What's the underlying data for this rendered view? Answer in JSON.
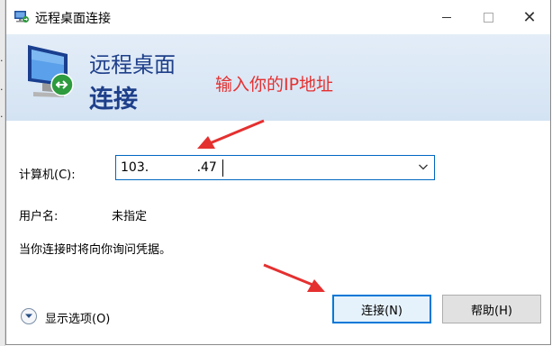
{
  "window": {
    "title": "远程桌面连接",
    "min_label": "",
    "max_label": "",
    "close_label": "✕"
  },
  "banner": {
    "line1": "远程桌面",
    "line2": "连接",
    "annotation": "输入你的IP地址"
  },
  "form": {
    "computer_label": "计算机(C):",
    "computer_value": "103.            .47",
    "user_label": "用户名:",
    "user_value": "未指定",
    "note": "当你连接时将向你询问凭据。"
  },
  "footer": {
    "options_label": "显示选项(O)",
    "connect_label": "连接(N)",
    "help_label": "帮助(H)"
  },
  "colors": {
    "annotation": "#e53030",
    "banner_text": "#1e3f8a",
    "accent": "#0078d7"
  }
}
